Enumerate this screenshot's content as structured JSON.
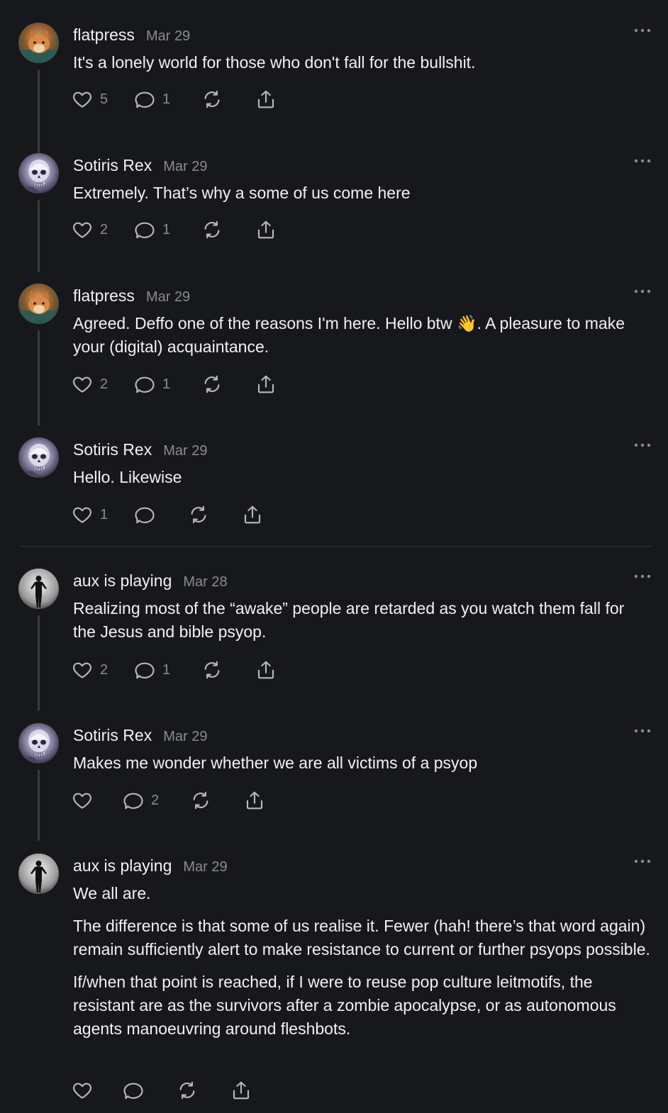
{
  "posts": [
    {
      "author": "flatpress",
      "date": "Mar 29",
      "avatar": "cat-avatar",
      "text": [
        "It's a lonely world for those who don't fall for the bullshit."
      ],
      "likes": "5",
      "replies": "1"
    },
    {
      "author": "Sotiris Rex",
      "date": "Mar 29",
      "avatar": "skull-avatar",
      "text": [
        "Extremely. That’s why a some of us come here"
      ],
      "likes": "2",
      "replies": "1"
    },
    {
      "author": "flatpress",
      "date": "Mar 29",
      "avatar": "cat-avatar",
      "text": [
        "Agreed. Deffo one of the reasons I'm here. Hello btw 👋. A pleasure to make your (digital) acquaintance."
      ],
      "likes": "2",
      "replies": "1"
    },
    {
      "author": "Sotiris Rex",
      "date": "Mar 29",
      "avatar": "skull-avatar",
      "text": [
        "Hello. Likewise"
      ],
      "likes": "1",
      "replies": ""
    },
    {
      "author": "aux is playing",
      "date": "Mar 28",
      "avatar": "silhouette-avatar",
      "text": [
        "Realizing most of the “awake” people are retarded as you watch them fall for the Jesus and bible psyop."
      ],
      "likes": "2",
      "replies": "1"
    },
    {
      "author": "Sotiris Rex",
      "date": "Mar 29",
      "avatar": "skull-avatar",
      "text": [
        "Makes me wonder whether we are all victims of a psyop"
      ],
      "likes": "",
      "replies": "2"
    },
    {
      "author": "aux is playing",
      "date": "Mar 29",
      "avatar": "silhouette-avatar",
      "text": [
        "We all are.",
        "The difference is that some of us realise it. Fewer (hah! there’s that word again) remain sufficiently alert to make resistance to current or further psyops possible.",
        "If/when that point is reached, if I were to reuse pop culture leitmotifs, the resistant are as the survivors after a zombie apocalypse, or as autonomous agents manoeuvring around fleshbots."
      ],
      "likes": "",
      "replies": ""
    }
  ],
  "icons": {
    "like": "heart-icon",
    "reply": "comment-icon",
    "repost": "repost-icon",
    "share": "share-icon",
    "more": "more-options-icon"
  },
  "colors": {
    "background": "#17181b",
    "text": "#f2f2f2",
    "muted": "#8a8b90",
    "line": "#3a3b3f"
  }
}
